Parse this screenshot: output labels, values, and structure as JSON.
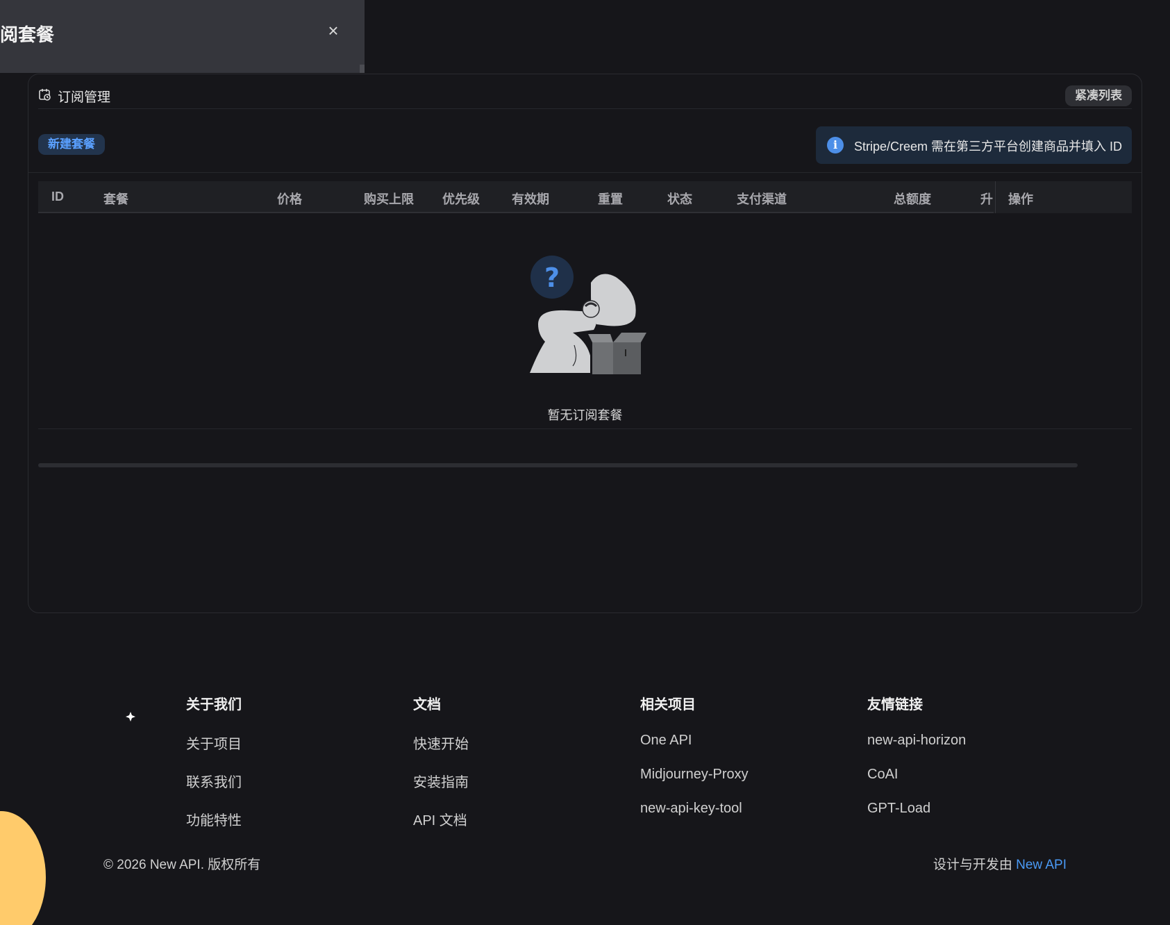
{
  "sheet": {
    "title": "阅套餐",
    "close_glyph": "×"
  },
  "card": {
    "title": "订阅管理",
    "compact_label": "紧凑列表",
    "new_button": "新建套餐",
    "info_text": "Stripe/Creem 需在第三方平台创建商品并填入 ID"
  },
  "table": {
    "columns": [
      "ID",
      "套餐",
      "价格",
      "购买上限",
      "优先级",
      "有效期",
      "重置",
      "状态",
      "支付渠道",
      "总额度",
      "升",
      "操作"
    ],
    "empty_text": "暂无订阅套餐"
  },
  "footer": {
    "columns": [
      {
        "title": "关于我们",
        "links": [
          "关于项目",
          "联系我们",
          "功能特性"
        ]
      },
      {
        "title": "文档",
        "links": [
          "快速开始",
          "安装指南",
          "API 文档"
        ]
      },
      {
        "title": "相关项目",
        "links": [
          "One API",
          "Midjourney-Proxy",
          "new-api-key-tool"
        ]
      },
      {
        "title": "友情链接",
        "links": [
          "new-api-horizon",
          "CoAI",
          "GPT-Load"
        ]
      }
    ],
    "copyright": "© 2026 New API. 版权所有",
    "made_by_prefix": "设计与开发由 ",
    "made_by_link": "New API"
  },
  "icons": {
    "card_header": "calendar-clock-icon",
    "info": "info-icon",
    "close": "close-icon",
    "logo": "new-api-logo"
  },
  "colors": {
    "background": "#16161a",
    "accent": "#4a9af5",
    "info_banner": "#1d2a3b",
    "new_button_bg": "#22344d"
  }
}
